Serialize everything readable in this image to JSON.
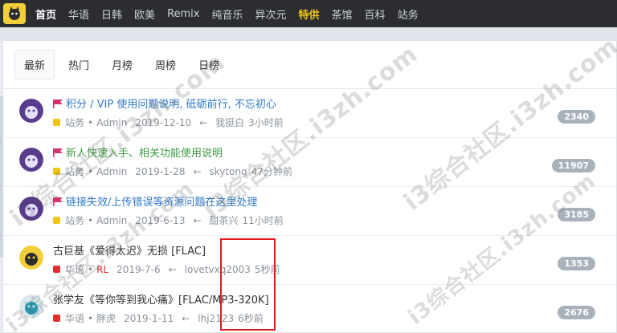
{
  "nav": {
    "items": [
      {
        "label": "首页",
        "state": "active"
      },
      {
        "label": "华语",
        "state": ""
      },
      {
        "label": "日韩",
        "state": ""
      },
      {
        "label": "欧美",
        "state": ""
      },
      {
        "label": "Remix",
        "state": ""
      },
      {
        "label": "纯音乐",
        "state": ""
      },
      {
        "label": "异次元",
        "state": ""
      },
      {
        "label": "特供",
        "state": "hot"
      },
      {
        "label": "茶馆",
        "state": ""
      },
      {
        "label": "百科",
        "state": ""
      },
      {
        "label": "站务",
        "state": ""
      }
    ]
  },
  "tabs": [
    "最新",
    "热门",
    "月榜",
    "周榜",
    "日榜"
  ],
  "threads": [
    {
      "title": "积分 / VIP 使用问题说明, 砥砺前行, 不忘初心",
      "title_color": "blue",
      "pinned": true,
      "category": "站务",
      "category_color": "#f0c419",
      "author": "Admin",
      "date": "2019-12-10",
      "arrow": "←",
      "last_user": "我挺白",
      "last_time": "3小时前",
      "replies": "2340"
    },
    {
      "title": "新人快速入手、相关功能使用说明",
      "title_color": "green",
      "pinned": true,
      "category": "站务",
      "category_color": "#f0c419",
      "author": "Admin",
      "date": "2019-1-28",
      "arrow": "←",
      "last_user": "skytong",
      "last_time": "47分钟前",
      "replies": "11907"
    },
    {
      "title": "链接失效/上传错误等资源问题在这里处理",
      "title_color": "blue",
      "pinned": true,
      "category": "站务",
      "category_color": "#f0c419",
      "author": "Admin",
      "date": "2019-6-13",
      "arrow": "←",
      "last_user": "甜茶兴",
      "last_time": "11小时前",
      "replies": "3185"
    },
    {
      "title": "古巨基《爱得太迟》无损 [FLAC]",
      "title_color": "",
      "pinned": false,
      "category": "华语",
      "category_color": "#e02d2d",
      "author": "RL",
      "date": "2019-7-6",
      "arrow": "←",
      "last_user": "lovetvxq2003",
      "last_time": "5秒前",
      "replies": "1353"
    },
    {
      "title": "张学友《等你等到我心痛》[FLAC/MP3-320K]",
      "title_color": "",
      "pinned": false,
      "category": "华语",
      "category_color": "#e02d2d",
      "author": "胖虎",
      "date": "2019-1-11",
      "arrow": "←",
      "last_user": "lhj2123",
      "last_time": "6秒前",
      "replies": "2676"
    }
  ],
  "watermark": "i3综合社区.i3zh.com",
  "colors": {
    "nav_bg": "#2b2d31",
    "accent_yellow": "#f0c419",
    "badge_bg": "#a9b2bb",
    "highlight_red": "#e01b1b"
  }
}
